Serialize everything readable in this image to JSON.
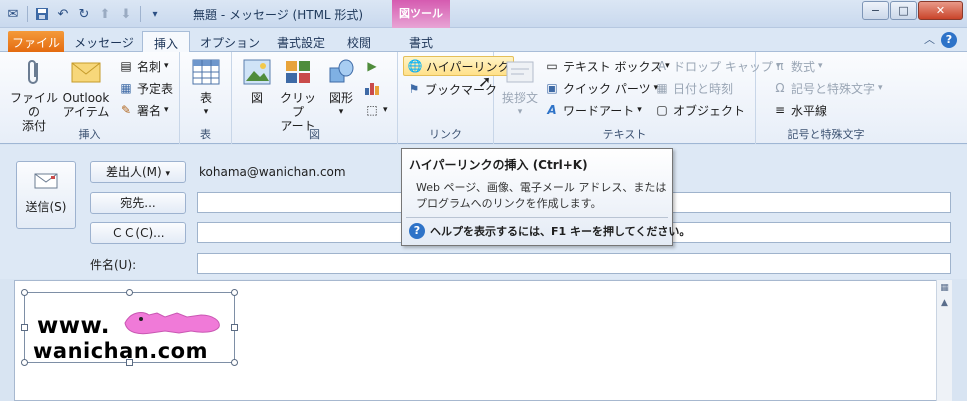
{
  "window": {
    "title": "無題 - メッセージ (HTML 形式)",
    "context_tab": "図ツール",
    "minimize": "−",
    "maximize": "□",
    "close": "✕"
  },
  "tabs": [
    {
      "label": "ファイル"
    },
    {
      "label": "メッセージ"
    },
    {
      "label": "挿入"
    },
    {
      "label": "オプション"
    },
    {
      "label": "書式設定"
    },
    {
      "label": "校閲"
    },
    {
      "label": "書式"
    }
  ],
  "ribbon": {
    "include": {
      "label": "挿入",
      "attach_file": [
        "ファイルの",
        "添付"
      ],
      "outlook_item": [
        "Outlook",
        "アイテム"
      ],
      "business_card": "名刺",
      "calendar": "予定表",
      "signature": "署名"
    },
    "tables": {
      "label": "表",
      "table": "表"
    },
    "illustrations": {
      "label": "図",
      "picture": "図",
      "clip_art": [
        "クリップ",
        "アート"
      ],
      "shapes": "図形"
    },
    "links": {
      "label": "リンク",
      "hyperlink": "ハイパーリンク",
      "bookmark": "ブックマーク"
    },
    "text": {
      "label": "テキスト",
      "greeting": "挨拶文",
      "text_box": "テキスト ボックス",
      "quick_parts": "クイック パーツ",
      "wordart": "ワードアート",
      "drop_cap": "ドロップ キャップ",
      "date_time": "日付と時刻",
      "object": "オブジェクト"
    },
    "symbols": {
      "label": "記号と特殊文字",
      "equation": "数式",
      "symbol": "記号と特殊文字",
      "horizontal_line": "水平線"
    }
  },
  "form": {
    "send": "送信(S)",
    "from_button": "差出人(M)",
    "from_value": "kohama@wanichan.com",
    "to_button": "宛先...",
    "cc_button": "ＣＣ(C)...",
    "subject_label": "件名(U):"
  },
  "tooltip": {
    "title": "ハイパーリンクの挿入 (Ctrl+K)",
    "description": "Web ページ、画像、電子メール アドレス、またはプログラムへのリンクを作成します。",
    "help": "ヘルプを表示するには、F1 キーを押してください。"
  },
  "body": {
    "logo_line1": "www.",
    "logo_line2": "wanichan.com"
  },
  "colors": {
    "file_tab": "#e46b10",
    "context_tab": "#d55bb0",
    "accent": "#2e73c8",
    "logo_shape": "#f07ad8"
  }
}
